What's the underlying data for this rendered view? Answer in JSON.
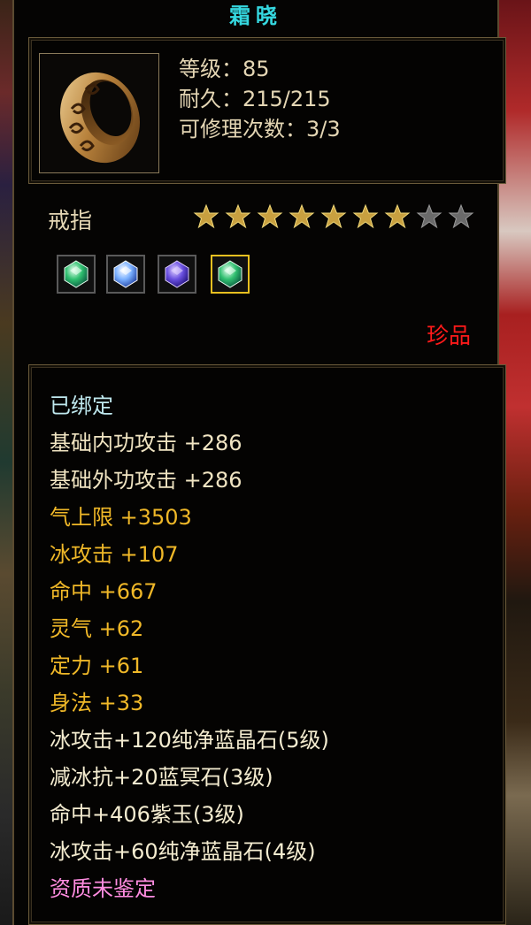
{
  "item": {
    "name": "霜晓",
    "level": "等级：85",
    "durability": "耐久：215/215",
    "repair_count": "可修理次数：3/3",
    "type": "戒指",
    "rarity": "珍品",
    "stars_filled": 7,
    "stars_total": 9,
    "icon": "gold-ring-icon"
  },
  "gems": [
    {
      "icon": "green-gem-icon",
      "selected": false
    },
    {
      "icon": "blue-crystal-gem-icon",
      "selected": false
    },
    {
      "icon": "purple-gem-icon",
      "selected": false
    },
    {
      "icon": "green-gem-icon",
      "selected": true
    }
  ],
  "attributes": {
    "bound": "已绑定",
    "base": [
      "基础内功攻击  +286",
      "基础外功攻击  +286"
    ],
    "bonus": [
      "气上限  +3503",
      "冰攻击  +107",
      "命中  +667",
      "灵气  +62",
      "定力  +61",
      "身法  +33"
    ],
    "gems": [
      "冰攻击+120纯净蓝晶石(5级)",
      "减冰抗+20蓝冥石(3级)",
      "命中+406紫玉(3级)",
      "冰攻击+60纯净蓝晶石(4级)"
    ],
    "quality": "资质未鉴定"
  },
  "colors": {
    "title": "#35d8e0",
    "bound": "#bfe8ee",
    "base": "#f0e4c2",
    "bonus": "#f0b828",
    "gem_line": "#f4ecd0",
    "quality": "#ff8ce0",
    "rarity": "#ff1a1a",
    "star_filled": "#c8a040",
    "star_empty": "#6a6a6a"
  }
}
